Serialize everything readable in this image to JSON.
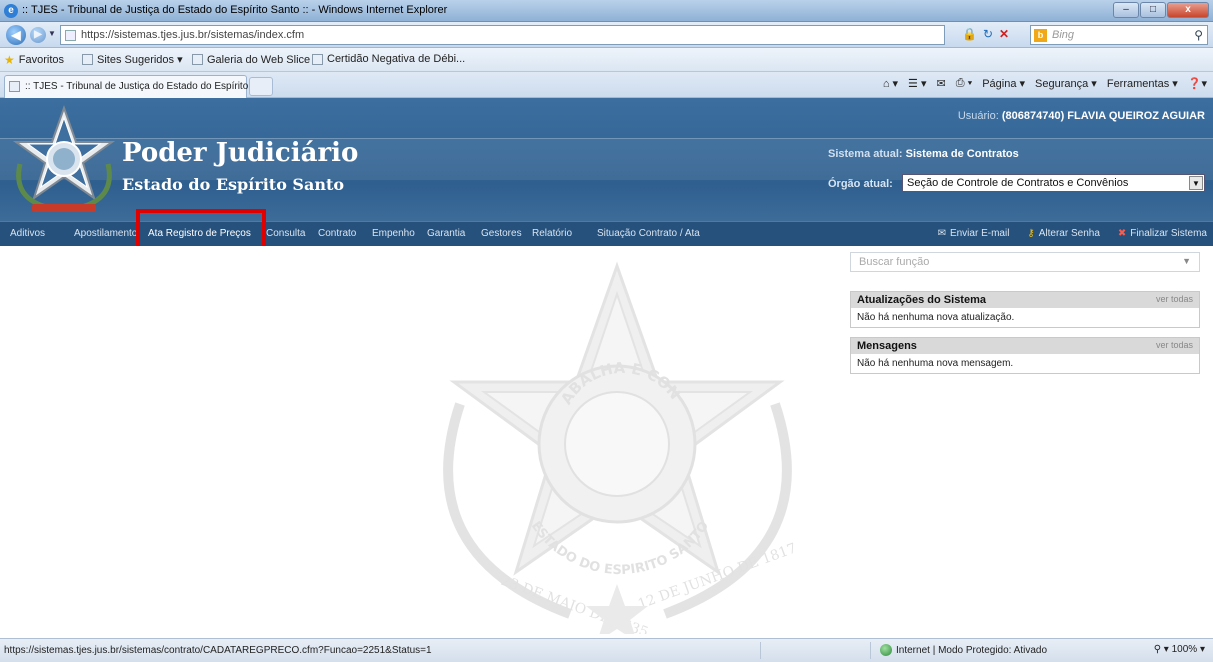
{
  "browser": {
    "window_title": ":: TJES - Tribunal de Justiça do Estado do Espírito Santo :: - Windows Internet Explorer",
    "url": "https://sistemas.tjes.jus.br/sistemas/index.cfm",
    "search_placeholder": "Bing",
    "favorites": [
      {
        "label": "Favoritos"
      },
      {
        "label": "Sites Sugeridos ▾"
      },
      {
        "label": "Galeria do Web Slice ▾"
      },
      {
        "label": "Certidão Negativa de Débi..."
      }
    ],
    "tab_label": ":: TJES - Tribunal de Justiça do Estado do Espírito ...",
    "commands": [
      "Página ▾",
      "Segurança ▾",
      "Ferramentas ▾"
    ],
    "window_controls": [
      "–",
      "□",
      "x"
    ]
  },
  "header": {
    "title": "Poder Judiciário",
    "subtitle": "Estado do Espírito Santo",
    "user_label": "Usuário:",
    "user_value": "(806874740) FLAVIA QUEIROZ AGUIAR",
    "system_label": "Sistema atual:",
    "system_value": "Sistema de Contratos",
    "orgao_label": "Órgão atual:",
    "orgao_value": "Seção de Controle de Contratos e Convênios"
  },
  "menu": {
    "items": [
      {
        "label": "Aditivos"
      },
      {
        "label": "Apostilamento"
      },
      {
        "label": "Ata Registro de Preços"
      },
      {
        "label": "Consulta"
      },
      {
        "label": "Contrato"
      },
      {
        "label": "Empenho"
      },
      {
        "label": "Garantia"
      },
      {
        "label": "Gestores"
      },
      {
        "label": "Relatório"
      },
      {
        "label": "Situação Contrato / Ata"
      }
    ],
    "right": [
      {
        "label": "Enviar E-mail"
      },
      {
        "label": "Alterar Senha"
      },
      {
        "label": "Finalizar Sistema"
      }
    ]
  },
  "sidebar": {
    "search_placeholder": "Buscar função",
    "updates_title": "Atualizações do Sistema",
    "updates_link": "ver todas",
    "updates_text": "Não há nenhuma nova atualização.",
    "messages_title": "Mensagens",
    "messages_link": "ver todas",
    "messages_text": "Não há nenhuma nova mensagem."
  },
  "watermark": {
    "motto": "TRABALHA E CONFIA",
    "state": "ESTADO DO ESPIRITO SANTO",
    "date1": "23 DE MAIO DE 1535",
    "date2": "12 DE JUNHO DE 1817"
  },
  "status": {
    "url": "https://sistemas.tjes.jus.br/sistemas/contrato/CADATAREGPRECO.cfm?Funcao=2251&Status=1",
    "zone": "Internet | Modo Protegido: Ativado",
    "zoom": "100%"
  },
  "colors": {
    "header_blue": "#2f5f8f",
    "menu_blue": "#26517c",
    "highlight_red": "#e00000"
  }
}
